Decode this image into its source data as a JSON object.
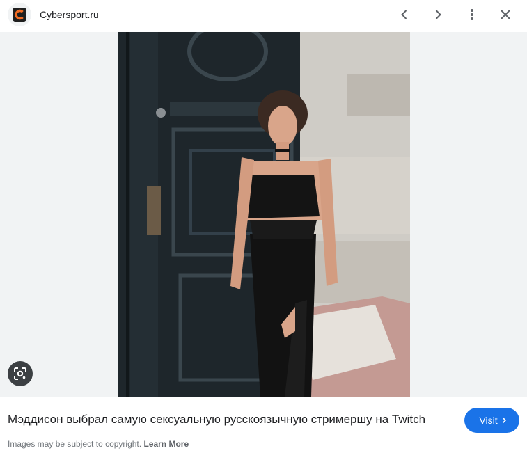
{
  "header": {
    "site_name": "Cybersport.ru",
    "favicon_letter": "C",
    "icons": [
      "chevron-left-icon",
      "chevron-right-icon",
      "more-vert-icon",
      "close-icon"
    ]
  },
  "image": {
    "lens_icon": "google-lens-icon"
  },
  "footer": {
    "caption": "Мэддисон выбрал самую сексуальную русскоязычную стримершу на Twitch",
    "visit_label": "Visit",
    "copyright_text": "Images may be subject to copyright.",
    "learn_more": "Learn More"
  },
  "colors": {
    "accent": "#1a73e8",
    "viewer_bg": "#f1f3f4",
    "favicon_orange": "#f26b21"
  }
}
